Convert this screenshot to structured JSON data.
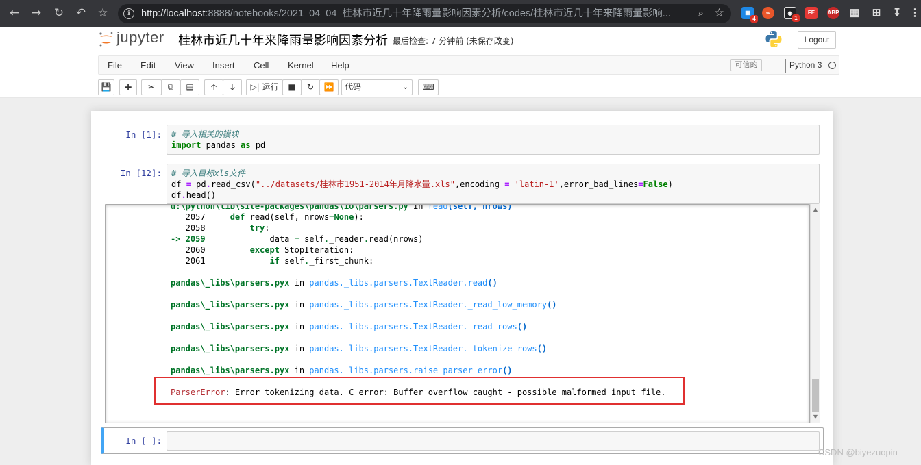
{
  "browser": {
    "url_host": "http://localhost",
    "url_rest": ":8888/notebooks/2021_04_04_桂林市近几十年降雨量影响因素分析/codes/桂林市近几十年来降雨量影响...",
    "extension_badges": {
      "ext1": "4",
      "ext3": "1"
    },
    "ext_labels": {
      "fe": "FE",
      "abp": "ABP"
    }
  },
  "jupyter": {
    "logo_text": "jupyter",
    "title": "桂林市近几十年来降雨量影响因素分析",
    "checkpoint": "最后检查: 7 分钟前  (未保存改变)",
    "logout": "Logout"
  },
  "menu": {
    "items": [
      "File",
      "Edit",
      "View",
      "Insert",
      "Cell",
      "Kernel",
      "Help"
    ],
    "trusted": "可信的",
    "kernel": "Python 3"
  },
  "toolbar": {
    "run_label": "运行",
    "cell_type": "代码"
  },
  "cells": [
    {
      "prompt": "In  [1]:",
      "lines": [
        [
          {
            "t": "# 导入相关的模块",
            "c": "c-comment"
          }
        ],
        [
          {
            "t": "import",
            "c": "c-kw"
          },
          {
            "t": " pandas "
          },
          {
            "t": "as",
            "c": "c-kw"
          },
          {
            "t": " pd"
          }
        ]
      ]
    },
    {
      "prompt": "In  [12]:",
      "lines": [
        [
          {
            "t": "# 导入目标xls文件",
            "c": "c-comment"
          }
        ],
        [
          {
            "t": "df "
          },
          {
            "t": "=",
            "c": "c-op"
          },
          {
            "t": " pd"
          },
          {
            "t": ".",
            "c": "c-op"
          },
          {
            "t": "read_csv("
          },
          {
            "t": "\"../datasets/桂林市1951-2014年月降水量.xls\"",
            "c": "c-str"
          },
          {
            "t": ",encoding "
          },
          {
            "t": "=",
            "c": "c-op"
          },
          {
            "t": " "
          },
          {
            "t": "'latin-1'",
            "c": "c-str"
          },
          {
            "t": ",error_bad_lines"
          },
          {
            "t": "=",
            "c": "c-op"
          },
          {
            "t": "False",
            "c": "c-kw"
          },
          {
            "t": ")"
          }
        ],
        [
          {
            "t": "df"
          },
          {
            "t": ".",
            "c": "c-op"
          },
          {
            "t": "head()"
          }
        ]
      ]
    }
  ],
  "output": {
    "lines": [
      [
        {
          "t": "d:\\python\\lib\\site-packages\\pandas\\io\\parsers.py",
          "c": "g-bold"
        },
        {
          "t": " in "
        },
        {
          "t": "read",
          "c": "cyan"
        },
        {
          "t": "(self, nrows)",
          "c": "blue-bold"
        }
      ],
      [
        {
          "t": "   2057     "
        },
        {
          "t": "def",
          "c": "g-bold"
        },
        {
          "t": " read(self, nrows"
        },
        {
          "t": "=",
          "c": "g-green"
        },
        {
          "t": "None",
          "c": "g-bold"
        },
        {
          "t": "):"
        }
      ],
      [
        {
          "t": "   2058         "
        },
        {
          "t": "try",
          "c": "g-bold"
        },
        {
          "t": ":"
        }
      ],
      [
        {
          "t": "-> 2059",
          "c": "g-bold"
        },
        {
          "t": "             data "
        },
        {
          "t": "=",
          "c": "g-green"
        },
        {
          "t": " self"
        },
        {
          "t": ".",
          "c": "g-green"
        },
        {
          "t": "_reader"
        },
        {
          "t": ".",
          "c": "g-green"
        },
        {
          "t": "read(nrows)"
        }
      ],
      [
        {
          "t": "   2060         "
        },
        {
          "t": "except",
          "c": "g-bold"
        },
        {
          "t": " StopIteration:"
        }
      ],
      [
        {
          "t": "   2061             "
        },
        {
          "t": "if",
          "c": "g-bold"
        },
        {
          "t": " self"
        },
        {
          "t": ".",
          "c": "g-green"
        },
        {
          "t": "_first_chunk:"
        }
      ],
      [],
      [
        {
          "t": "pandas\\_libs\\parsers.pyx",
          "c": "g-bold"
        },
        {
          "t": " in "
        },
        {
          "t": "pandas._libs.parsers.TextReader.read",
          "c": "cyan"
        },
        {
          "t": "()",
          "c": "blue-bold"
        }
      ],
      [],
      [
        {
          "t": "pandas\\_libs\\parsers.pyx",
          "c": "g-bold"
        },
        {
          "t": " in "
        },
        {
          "t": "pandas._libs.parsers.TextReader._read_low_memory",
          "c": "cyan"
        },
        {
          "t": "()",
          "c": "blue-bold"
        }
      ],
      [],
      [
        {
          "t": "pandas\\_libs\\parsers.pyx",
          "c": "g-bold"
        },
        {
          "t": " in "
        },
        {
          "t": "pandas._libs.parsers.TextReader._read_rows",
          "c": "cyan"
        },
        {
          "t": "()",
          "c": "blue-bold"
        }
      ],
      [],
      [
        {
          "t": "pandas\\_libs\\parsers.pyx",
          "c": "g-bold"
        },
        {
          "t": " in "
        },
        {
          "t": "pandas._libs.parsers.TextReader._tokenize_rows",
          "c": "cyan"
        },
        {
          "t": "()",
          "c": "blue-bold"
        }
      ],
      [],
      [
        {
          "t": "pandas\\_libs\\parsers.pyx",
          "c": "g-bold"
        },
        {
          "t": " in "
        },
        {
          "t": "pandas._libs.parsers.raise_parser_error",
          "c": "cyan"
        },
        {
          "t": "()",
          "c": "blue-bold"
        }
      ],
      [],
      [
        {
          "t": "ParserError",
          "c": "red-bold"
        },
        {
          "t": ": Error tokenizing data. C error: Buffer overflow caught - possible malformed input file."
        }
      ]
    ]
  },
  "empty_cell": {
    "prompt": "In  [ ]:"
  },
  "watermark": "CSDN @biyezuopin"
}
